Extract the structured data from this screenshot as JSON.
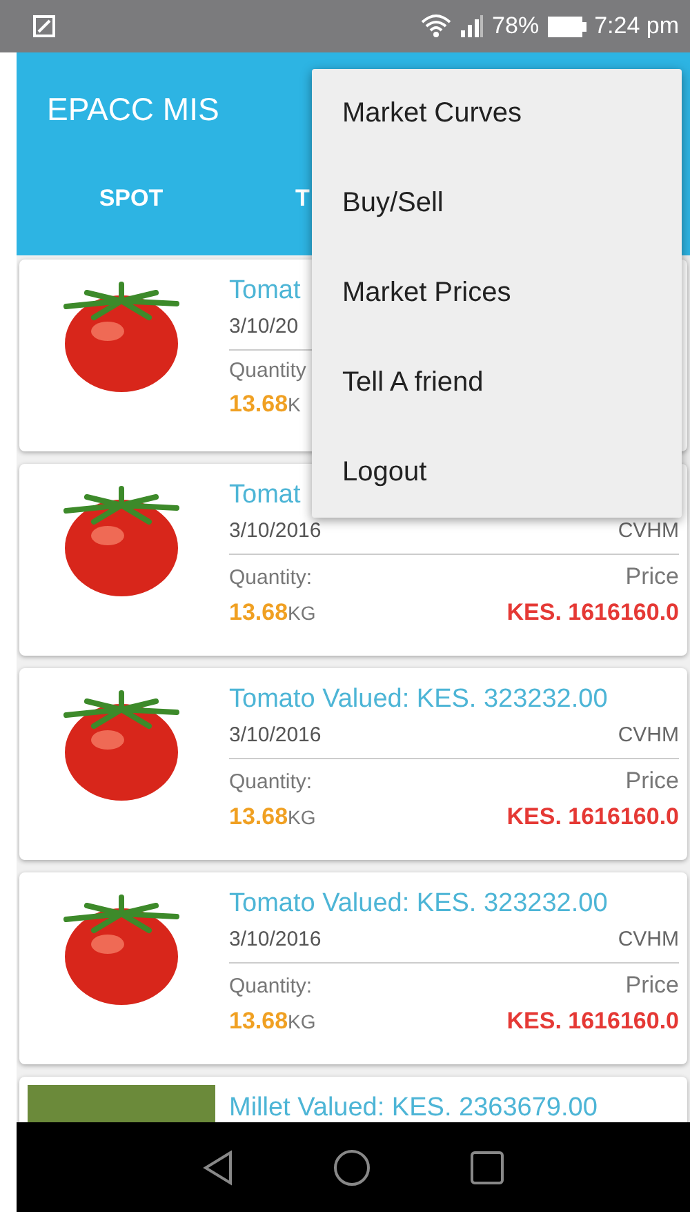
{
  "status_bar": {
    "battery": "78%",
    "time": "7:24 pm"
  },
  "app_bar": {
    "title": "EPACC MIS"
  },
  "tabs": [
    {
      "label": "SPOT"
    },
    {
      "label": "T"
    }
  ],
  "cards": [
    {
      "kind": "tomato",
      "title": "Tomat",
      "date": "3/10/20",
      "quantity_label": "Quantity",
      "quantity": "13.68",
      "unit": "K"
    },
    {
      "kind": "tomato",
      "title": "Tomat",
      "date": "3/10/2016",
      "code": "CVHM",
      "quantity_label": "Quantity:",
      "price_label": "Price",
      "quantity": "13.68",
      "unit": "KG",
      "price": "KES. 1616160.0"
    },
    {
      "kind": "tomato",
      "title": "Tomato Valued: KES. 323232.00",
      "date": "3/10/2016",
      "code": "CVHM",
      "quantity_label": "Quantity:",
      "price_label": "Price",
      "quantity": "13.68",
      "unit": "KG",
      "price": "KES. 1616160.0"
    },
    {
      "kind": "tomato",
      "title": "Tomato Valued: KES. 323232.00",
      "date": "3/10/2016",
      "code": "CVHM",
      "quantity_label": "Quantity:",
      "price_label": "Price",
      "quantity": "13.68",
      "unit": "KG",
      "price": "KES. 1616160.0"
    },
    {
      "kind": "millet",
      "title": "Millet Valued: KES. 2363679.00"
    }
  ],
  "menu": [
    "Market Curves",
    "Buy/Sell",
    "Market Prices",
    "Tell A friend",
    "Logout"
  ]
}
